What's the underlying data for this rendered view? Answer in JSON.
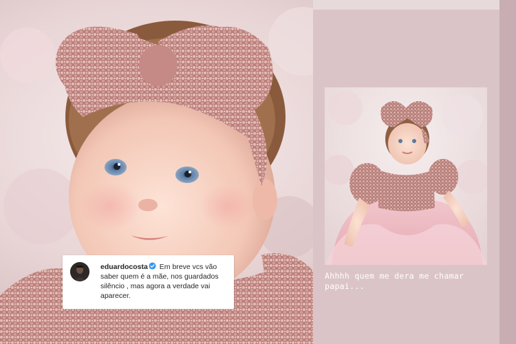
{
  "comment": {
    "username": "eduardocosta",
    "text": "Em breve vcs vão saber quem é a mãe, nos guardados silêncio , mas agora a verdade vai aparecer."
  },
  "story": {
    "caption": "Ahhhh quem me dera me chamar papai..."
  },
  "icons": {
    "verified": "verified-badge-icon",
    "avatar": "profile-avatar"
  },
  "colors": {
    "verified_blue": "#3897f0",
    "story_background": "#dbc4c8",
    "sequin_pink": "#c98f8f"
  }
}
